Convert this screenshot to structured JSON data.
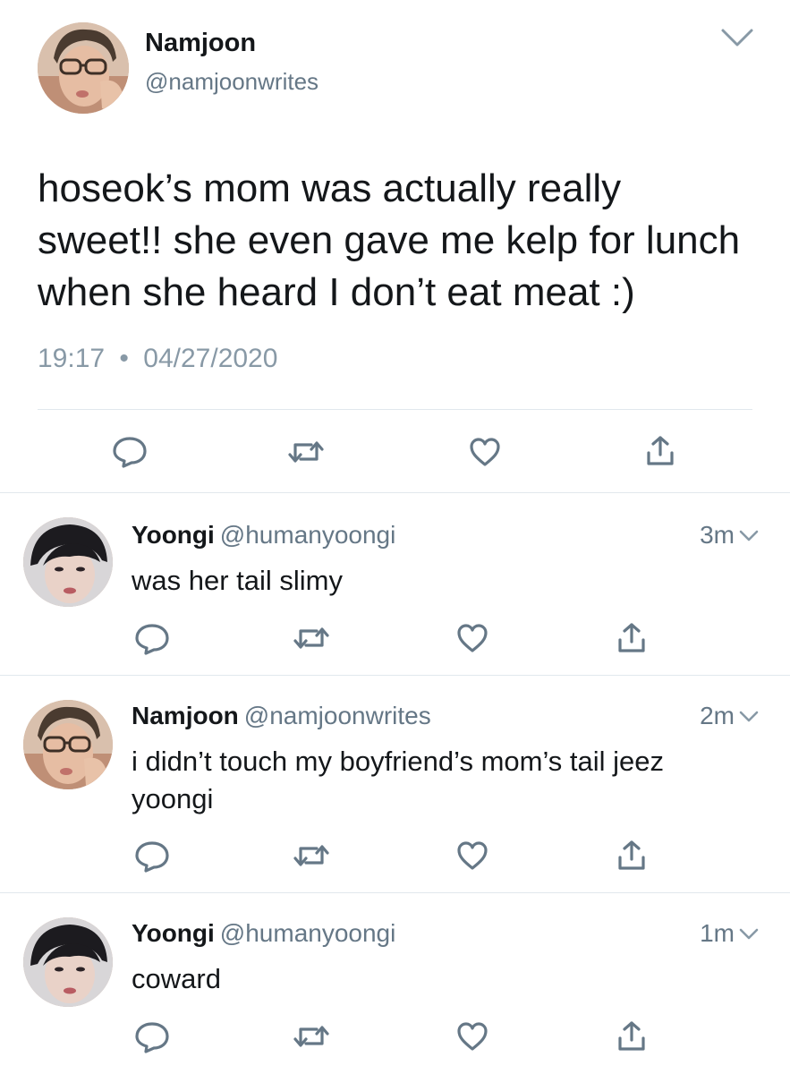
{
  "main_tweet": {
    "name": "Namjoon",
    "handle": "@namjoonwrites",
    "text": "hoseok’s mom was actually really\nsweet!! she even gave me kelp for lunch\nwhen she heard I don’t eat meat :)",
    "time": "19:17",
    "separator": "•",
    "date": "04/27/2020"
  },
  "replies": [
    {
      "name": "Yoongi",
      "handle": "@humanyoongi",
      "time": "3m",
      "text": "was her tail slimy"
    },
    {
      "name": "Namjoon",
      "handle": "@namjoonwrites",
      "time": "2m",
      "text": "i didn’t touch my boyfriend’s mom’s tail jeez yoongi"
    },
    {
      "name": "Yoongi",
      "handle": "@humanyoongi",
      "time": "1m",
      "text": "coward"
    }
  ],
  "icons": {
    "reply": "reply-icon",
    "retweet": "retweet-icon",
    "like": "heart-icon",
    "share": "share-icon",
    "caret": "chevron-down-icon"
  },
  "colors": {
    "text_primary": "#14171a",
    "text_secondary": "#657786",
    "meta_gray": "#8899a6",
    "icon_gray": "#657786",
    "divider": "#e1e8ed"
  }
}
